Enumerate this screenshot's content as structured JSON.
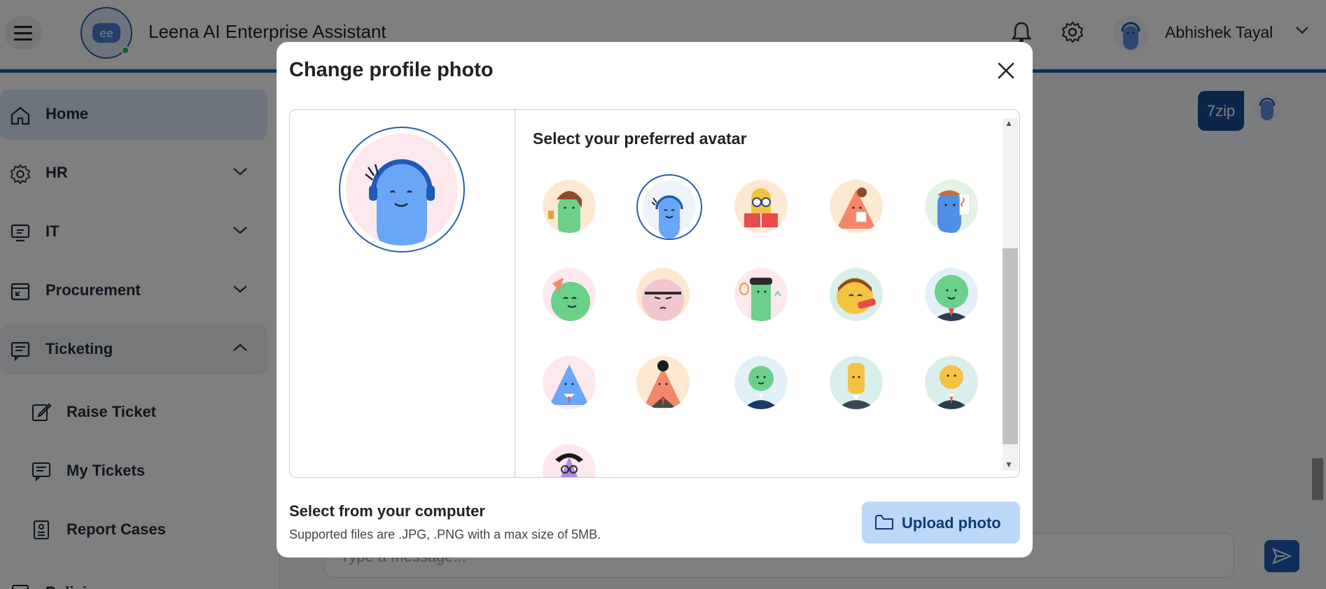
{
  "header": {
    "app_title": "Leena AI Enterprise Assistant",
    "user_name": "Abhishek Tayal"
  },
  "sidebar": {
    "items": [
      {
        "label": "Home",
        "icon": "home-icon",
        "state": "active"
      },
      {
        "label": "HR",
        "icon": "gear-icon",
        "state": "collapsed"
      },
      {
        "label": "IT",
        "icon": "it-icon",
        "state": "collapsed"
      },
      {
        "label": "Procurement",
        "icon": "procurement-icon",
        "state": "collapsed"
      },
      {
        "label": "Ticketing",
        "icon": "ticketing-icon",
        "state": "expanded"
      },
      {
        "label": "Policies",
        "icon": "policies-icon",
        "state": "collapsed"
      }
    ],
    "ticketing_sub": [
      {
        "label": "Raise Ticket",
        "icon": "edit-icon"
      },
      {
        "label": "My Tickets",
        "icon": "tickets-icon"
      },
      {
        "label": "Report Cases",
        "icon": "report-icon"
      }
    ]
  },
  "chat": {
    "bubble_text": "7zip",
    "input_placeholder": "Type a message..."
  },
  "modal": {
    "title": "Change profile photo",
    "picker_title": "Select your preferred avatar",
    "upload_title": "Select from your computer",
    "upload_help": "Supported files are .JPG, .PNG with a max size of 5MB.",
    "upload_button": "Upload photo",
    "selected_avatar_index": 1
  },
  "colors": {
    "brand": "#1d5bb5",
    "active_nav": "#dbe8fb",
    "upload_button_bg": "#bcd7f7"
  }
}
